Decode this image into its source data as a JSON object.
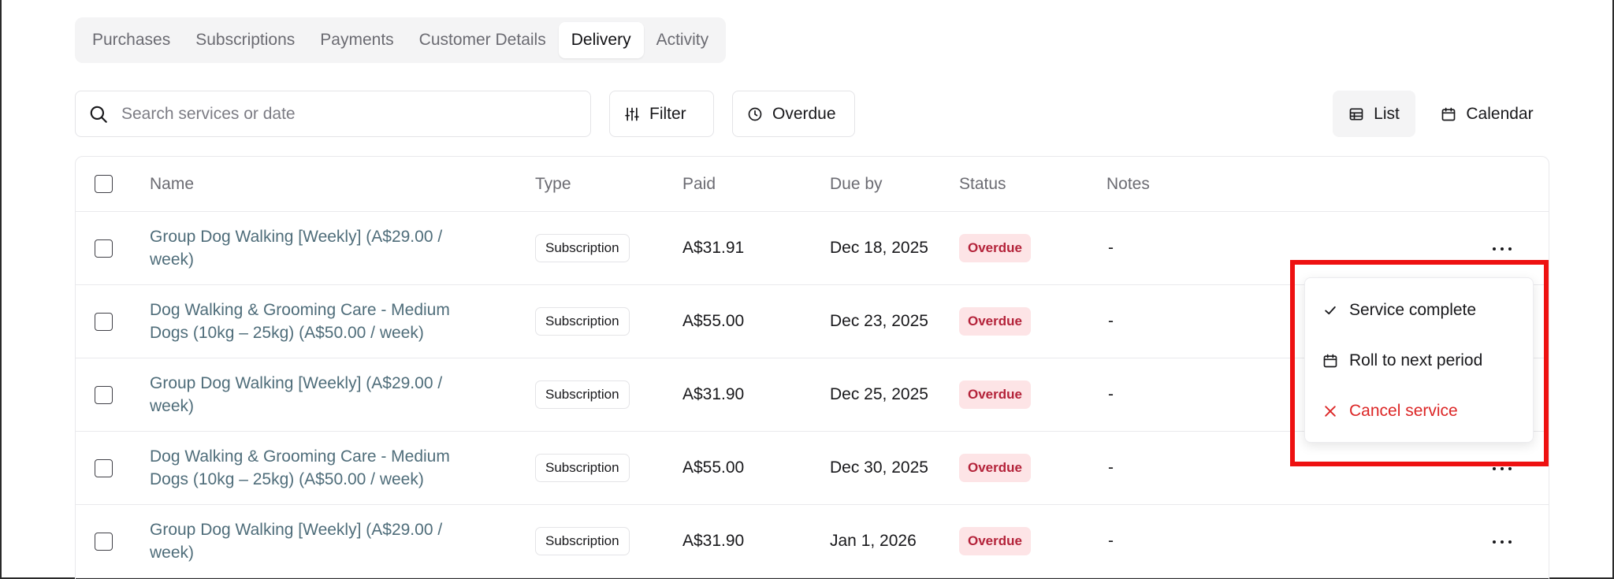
{
  "tabs": [
    {
      "label": "Purchases",
      "active": false
    },
    {
      "label": "Subscriptions",
      "active": false
    },
    {
      "label": "Payments",
      "active": false
    },
    {
      "label": "Customer Details",
      "active": false
    },
    {
      "label": "Delivery",
      "active": true
    },
    {
      "label": "Activity",
      "active": false
    }
  ],
  "toolbar": {
    "search_placeholder": "Search services or date",
    "filter_label": "Filter",
    "overdue_label": "Overdue",
    "list_label": "List",
    "calendar_label": "Calendar"
  },
  "table": {
    "columns": [
      "Name",
      "Type",
      "Paid",
      "Due by",
      "Status",
      "Notes"
    ],
    "rows": [
      {
        "name": "Group Dog Walking [Weekly] (A$29.00 / week)",
        "type": "Subscription",
        "paid": "A$31.91",
        "due": "Dec 18, 2025",
        "status": "Overdue",
        "notes": "-"
      },
      {
        "name": "Dog Walking & Grooming Care - Medium Dogs (10kg – 25kg) (A$50.00 / week)",
        "type": "Subscription",
        "paid": "A$55.00",
        "due": "Dec 23, 2025",
        "status": "Overdue",
        "notes": "-"
      },
      {
        "name": "Group Dog Walking [Weekly] (A$29.00 / week)",
        "type": "Subscription",
        "paid": "A$31.90",
        "due": "Dec 25, 2025",
        "status": "Overdue",
        "notes": "-"
      },
      {
        "name": "Dog Walking & Grooming Care - Medium Dogs (10kg – 25kg) (A$50.00 / week)",
        "type": "Subscription",
        "paid": "A$55.00",
        "due": "Dec 30, 2025",
        "status": "Overdue",
        "notes": "-"
      },
      {
        "name": "Group Dog Walking [Weekly] (A$29.00 / week)",
        "type": "Subscription",
        "paid": "A$31.90",
        "due": "Jan 1, 2026",
        "status": "Overdue",
        "notes": "-"
      }
    ]
  },
  "menu": {
    "items": [
      {
        "label": "Service complete",
        "icon": "check-icon"
      },
      {
        "label": "Roll to next period",
        "icon": "calendar-icon"
      },
      {
        "label": "Cancel service",
        "icon": "x-icon"
      }
    ]
  },
  "colors": {
    "accent_link": "#4f6d7a",
    "overdue_bg": "#fde4e6",
    "overdue_text": "#b4233a",
    "danger": "#dc2626",
    "highlight": "#ee1111"
  }
}
